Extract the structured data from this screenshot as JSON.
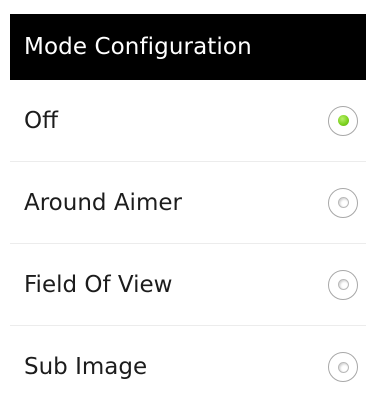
{
  "dialog": {
    "title": "Mode Configuration",
    "options": [
      {
        "label": "Off",
        "checked": true
      },
      {
        "label": "Around Aimer",
        "checked": false
      },
      {
        "label": "Field Of View",
        "checked": false
      },
      {
        "label": "Sub Image",
        "checked": false
      }
    ]
  },
  "colors": {
    "header_bg": "#000000",
    "header_text": "#ffffff",
    "selected_accent": "#7ed321"
  }
}
